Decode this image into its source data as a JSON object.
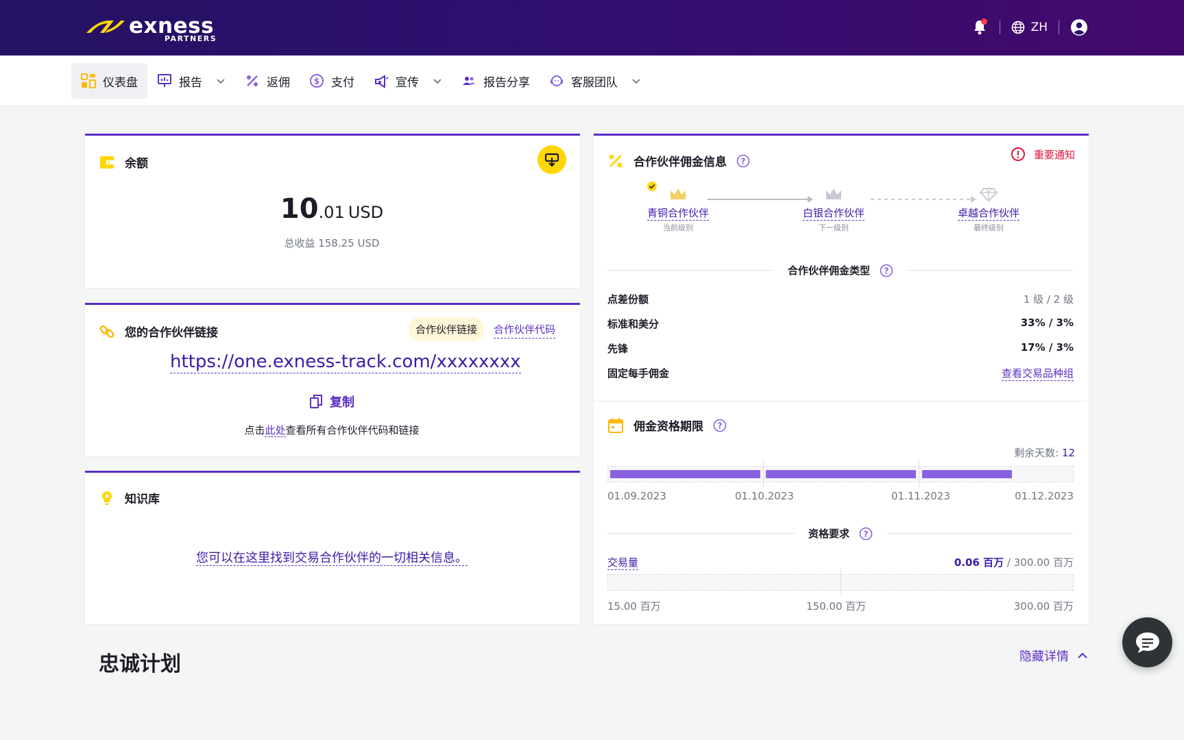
{
  "header": {
    "logo_text": "exness",
    "logo_sub": "PARTNERS",
    "language": "ZH",
    "icons": [
      "bell-icon",
      "globe-icon",
      "user-icon"
    ]
  },
  "nav": {
    "items": [
      {
        "label": "仪表盘",
        "icon": "dashboard-icon",
        "active": true
      },
      {
        "label": "报告",
        "icon": "report-icon",
        "dropdown": true
      },
      {
        "label": "返佣",
        "icon": "percent-icon"
      },
      {
        "label": "支付",
        "icon": "dollar-icon"
      },
      {
        "label": "宣传",
        "icon": "megaphone-icon",
        "dropdown": true
      },
      {
        "label": "报告分享",
        "icon": "people-icon"
      },
      {
        "label": "客服团队",
        "icon": "support-icon",
        "dropdown": true
      }
    ]
  },
  "balance": {
    "title": "余额",
    "amount_int": "10",
    "amount_dec": ".01",
    "currency": "USD",
    "total": "总收益 158.25 USD"
  },
  "partner_link": {
    "title": "您的合作伙伴链接",
    "tab_link": "合作伙伴链接",
    "tab_code": "合作伙伴代码",
    "url": "https://one.exness-track.com/xxxxxxxx",
    "copy": "复制",
    "hint_pre": "点击",
    "hint_link": "此处",
    "hint_post": "查看所有合作伙伴代码和链接"
  },
  "knowledge": {
    "title": "知识库",
    "text": "您可以在这里找到交易合作伙伴的一切相关信息。"
  },
  "commission": {
    "title": "合作伙伴佣金信息",
    "notice": "重要通知",
    "tiers": [
      {
        "name": "青铜合作伙伴",
        "sub": "当前级别"
      },
      {
        "name": "白银合作伙伴",
        "sub": "下一级别"
      },
      {
        "name": "卓越合作伙伴",
        "sub": "最终级别"
      }
    ],
    "type_title": "合作伙伴佣金类型",
    "rows": [
      {
        "k": "点差份额",
        "v": "1 级 / 2 级"
      },
      {
        "k": "标准和美分",
        "v": "33% / 3%"
      },
      {
        "k": "先锋",
        "v": "17% / 3%"
      },
      {
        "k": "固定每手佣金",
        "v": "查看交易品种组"
      }
    ]
  },
  "period": {
    "title": "佣金资格期限",
    "days_label": "剩余天数:",
    "days_value": "12",
    "dates": [
      "01.09.2023",
      "01.10.2023",
      "01.11.2023",
      "01.12.2023"
    ],
    "progress": [
      1.0,
      1.0,
      0.6
    ],
    "req_title": "资格要求",
    "volume_label": "交易量",
    "volume_current": "0.06 百万",
    "volume_sep": " / ",
    "volume_target": "300.00 百万",
    "volume_progress": 0.0002,
    "volume_ticks": [
      "15.00 百万",
      "150.00 百万",
      "300.00 百万"
    ]
  },
  "loyalty": {
    "title": "忠诚计划",
    "hide": "隐藏详情"
  }
}
